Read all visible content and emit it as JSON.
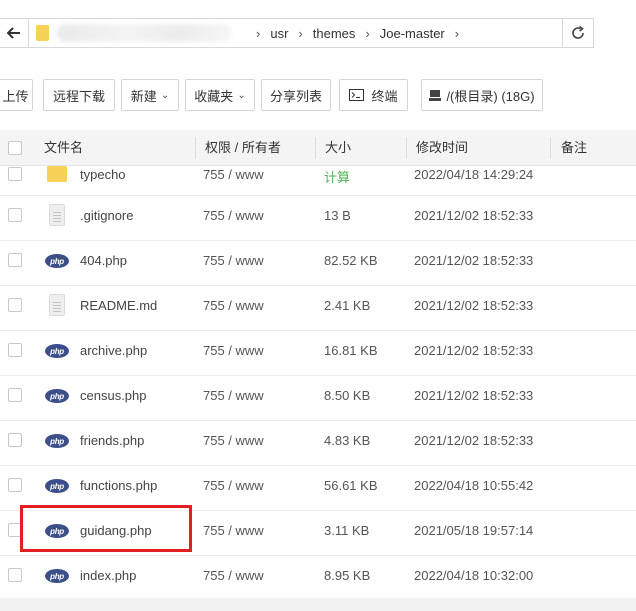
{
  "pathbar": {
    "crumbs": [
      "usr",
      "themes",
      "Joe-master"
    ],
    "separator": "›"
  },
  "toolbar": {
    "upload": "上传",
    "remote_download": "远程下载",
    "new": "新建",
    "favorites": "收藏夹",
    "share_list": "分享列表",
    "terminal": "终端",
    "disk": "/(根目录) (18G)"
  },
  "table": {
    "headers": {
      "name": "文件名",
      "perm": "权限 / 所有者",
      "size": "大小",
      "mtime": "修改时间",
      "note": "备注"
    },
    "rows": [
      {
        "icon": "folder",
        "name": "typecho",
        "perm": "755 / www",
        "size": "计算",
        "mtime": "2022/04/18 14:29:24"
      },
      {
        "icon": "doc",
        "name": ".gitignore",
        "perm": "755 / www",
        "size": "13 B",
        "mtime": "2021/12/02 18:52:33"
      },
      {
        "icon": "php",
        "name": "404.php",
        "perm": "755 / www",
        "size": "82.52 KB",
        "mtime": "2021/12/02 18:52:33"
      },
      {
        "icon": "doc",
        "name": "README.md",
        "perm": "755 / www",
        "size": "2.41 KB",
        "mtime": "2021/12/02 18:52:33"
      },
      {
        "icon": "php",
        "name": "archive.php",
        "perm": "755 / www",
        "size": "16.81 KB",
        "mtime": "2021/12/02 18:52:33"
      },
      {
        "icon": "php",
        "name": "census.php",
        "perm": "755 / www",
        "size": "8.50 KB",
        "mtime": "2021/12/02 18:52:33"
      },
      {
        "icon": "php",
        "name": "friends.php",
        "perm": "755 / www",
        "size": "4.83 KB",
        "mtime": "2021/12/02 18:52:33"
      },
      {
        "icon": "php",
        "name": "functions.php",
        "perm": "755 / www",
        "size": "56.61 KB",
        "mtime": "2022/04/18 10:55:42"
      },
      {
        "icon": "php",
        "name": "guidang.php",
        "perm": "755 / www",
        "size": "3.11 KB",
        "mtime": "2021/05/18 19:57:14"
      },
      {
        "icon": "php",
        "name": "index.php",
        "perm": "755 / www",
        "size": "8.95 KB",
        "mtime": "2022/04/18 10:32:00"
      }
    ]
  },
  "php_icon_text": "php",
  "colors": {
    "highlight": "#e41f24",
    "php_icon": "#3d4f88",
    "folder": "#f7d258",
    "calc_link": "#52b35a"
  }
}
